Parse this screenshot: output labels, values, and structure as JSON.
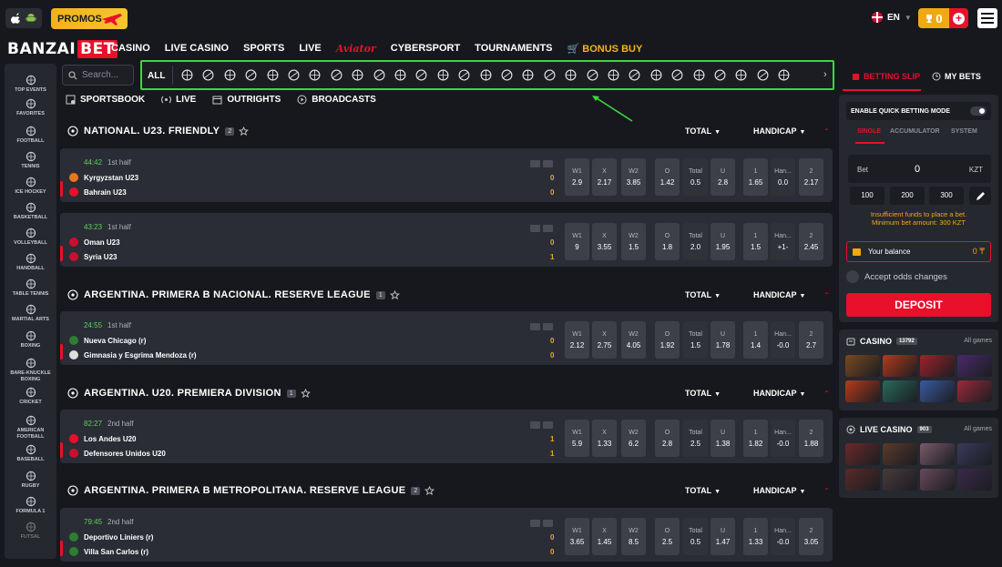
{
  "header": {
    "os_icons": [
      "apple-icon",
      "android-icon"
    ],
    "promos_label": "PROMOS",
    "language": "EN",
    "balance_badge": "0",
    "logo_text": "BANZAI",
    "logo_accent": "BET"
  },
  "nav": {
    "items": [
      "CASINO",
      "LIVE CASINO",
      "SPORTS",
      "LIVE",
      "Aviator",
      "CYBERSPORT",
      "TOURNAMENTS",
      "BONUS BUY"
    ]
  },
  "sidebar": {
    "items": [
      {
        "label": "TOP EVENTS",
        "icon": "fire-icon"
      },
      {
        "label": "FAVORITES",
        "icon": "star-icon"
      },
      {
        "label": "FOOTBALL",
        "icon": "football-icon"
      },
      {
        "label": "TENNIS",
        "icon": "tennis-icon"
      },
      {
        "label": "ICE HOCKEY",
        "icon": "hockey-icon"
      },
      {
        "label": "BASKETBALL",
        "icon": "basketball-icon"
      },
      {
        "label": "VOLLEYBALL",
        "icon": "volleyball-icon"
      },
      {
        "label": "HANDBALL",
        "icon": "handball-icon"
      },
      {
        "label": "TABLE TENNIS",
        "icon": "table-tennis-icon"
      },
      {
        "label": "MARTIAL ARTS",
        "icon": "martial-arts-icon"
      },
      {
        "label": "BOXING",
        "icon": "boxing-icon"
      },
      {
        "label": "BARE-KNUCKLE BOXING",
        "icon": "bare-knuckle-icon"
      },
      {
        "label": "CRICKET",
        "icon": "cricket-icon"
      },
      {
        "label": "AMERICAN FOOTBALL",
        "icon": "american-football-icon"
      },
      {
        "label": "BASEBALL",
        "icon": "baseball-icon"
      },
      {
        "label": "RUGBY",
        "icon": "rugby-icon"
      },
      {
        "label": "FORMULA 1",
        "icon": "formula1-icon"
      },
      {
        "label": "FUTSAL",
        "icon": "futsal-icon"
      }
    ]
  },
  "search": {
    "placeholder": "Search..."
  },
  "sports_bar": {
    "all_label": "ALL",
    "icon_count_note": "sport category icons",
    "next_icon": "chevron-right-icon"
  },
  "subtabs": [
    "SPORTSBOOK",
    "LIVE",
    "OUTRIGHTS",
    "BROADCASTS"
  ],
  "leagues": [
    {
      "name": "NATIONAL. U23. FRIENDLY",
      "count": "2",
      "col1": "TOTAL",
      "col2": "HANDICAP",
      "matches": [
        {
          "time": "44:42",
          "period": "1st half",
          "home": "Kyrgyzstan U23",
          "away": "Bahrain U23",
          "home_score": "0",
          "away_score": "0",
          "odds": [
            [
              "W1",
              "2.9"
            ],
            [
              "X",
              "2.17"
            ],
            [
              "W2",
              "3.85"
            ],
            [
              "O",
              "1.42"
            ],
            [
              "Total",
              "0.5"
            ],
            [
              "U",
              "2.8"
            ],
            [
              "1",
              "1.65"
            ],
            [
              "Han...",
              "0.0"
            ],
            [
              "2",
              "2.17"
            ]
          ]
        },
        {
          "time": "43:23",
          "period": "1st half",
          "home": "Oman U23",
          "away": "Syria U23",
          "home_score": "0",
          "away_score": "1",
          "odds": [
            [
              "W1",
              "9"
            ],
            [
              "X",
              "3.55"
            ],
            [
              "W2",
              "1.5"
            ],
            [
              "O",
              "1.8"
            ],
            [
              "Total",
              "2.0"
            ],
            [
              "U",
              "1.95"
            ],
            [
              "1",
              "1.5"
            ],
            [
              "Han...",
              "+1-"
            ],
            [
              "2",
              "2.45"
            ]
          ]
        }
      ]
    },
    {
      "name": "ARGENTINA. PRIMERA B NACIONAL. RESERVE LEAGUE",
      "count": "1",
      "col1": "TOTAL",
      "col2": "HANDICAP",
      "matches": [
        {
          "time": "24:55",
          "period": "1st half",
          "home": "Nueva Chicago (r)",
          "away": "Gimnasia y Esgrima Mendoza (r)",
          "home_score": "0",
          "away_score": "0",
          "odds": [
            [
              "W1",
              "2.12"
            ],
            [
              "X",
              "2.75"
            ],
            [
              "W2",
              "4.05"
            ],
            [
              "O",
              "1.92"
            ],
            [
              "Total",
              "1.5"
            ],
            [
              "U",
              "1.78"
            ],
            [
              "1",
              "1.4"
            ],
            [
              "Han...",
              "-0.0"
            ],
            [
              "2",
              "2.7"
            ]
          ]
        }
      ]
    },
    {
      "name": "ARGENTINA. U20. PREMIERA DIVISION",
      "count": "1",
      "col1": "TOTAL",
      "col2": "HANDICAP",
      "matches": [
        {
          "time": "82:27",
          "period": "2nd half",
          "home": "Los Andes U20",
          "away": "Defensores Unidos U20",
          "home_score": "1",
          "away_score": "1",
          "odds": [
            [
              "W1",
              "5.9"
            ],
            [
              "X",
              "1.33"
            ],
            [
              "W2",
              "6.2"
            ],
            [
              "O",
              "2.8"
            ],
            [
              "Total",
              "2.5"
            ],
            [
              "U",
              "1.38"
            ],
            [
              "1",
              "1.82"
            ],
            [
              "Han...",
              "-0.0"
            ],
            [
              "2",
              "1.88"
            ]
          ]
        }
      ]
    },
    {
      "name": "ARGENTINA. PRIMERA B METROPOLITANA. RESERVE LEAGUE",
      "count": "2",
      "col1": "TOTAL",
      "col2": "HANDICAP",
      "matches": [
        {
          "time": "79:45",
          "period": "2nd half",
          "home": "Deportivo Liniers (r)",
          "away": "Villa San Carlos (r)",
          "home_score": "0",
          "away_score": "0",
          "odds": [
            [
              "W1",
              "3.65"
            ],
            [
              "X",
              "1.45"
            ],
            [
              "W2",
              "8.5"
            ],
            [
              "O",
              "2.5"
            ],
            [
              "Total",
              "0.5"
            ],
            [
              "U",
              "1.47"
            ],
            [
              "1",
              "1.33"
            ],
            [
              "Han...",
              "-0.0"
            ],
            [
              "2",
              "3.05"
            ]
          ]
        }
      ]
    }
  ],
  "betslip": {
    "tab_slip": "BETTING SLIP",
    "tab_mybets": "MY BETS",
    "quick_betting": "ENABLE QUICK BETTING MODE",
    "bet_types": [
      "SINGLE",
      "ACCUMULATOR",
      "SYSTEM"
    ],
    "bet_label": "Bet",
    "bet_value": "0",
    "currency": "KZT",
    "quick_amounts": [
      "100",
      "200",
      "300"
    ],
    "warning_1": "Insufficient funds to place a bet.",
    "warning_2": "Minimum bet amount: 300 KZT",
    "balance_label": "Your balance",
    "balance_value": "0 ₸",
    "accept_odds": "Accept odds changes",
    "deposit": "DEPOSIT"
  },
  "casino_panel": {
    "title": "CASINO",
    "count": "13792",
    "all_games": "All games"
  },
  "live_casino_panel": {
    "title": "LIVE CASINO",
    "count": "903",
    "all_games": "All games"
  },
  "colors": {
    "accent_red": "#e8102a",
    "accent_gold": "#f0a913",
    "live_green": "#5ad45a",
    "highlight_border": "#3ad93a"
  }
}
